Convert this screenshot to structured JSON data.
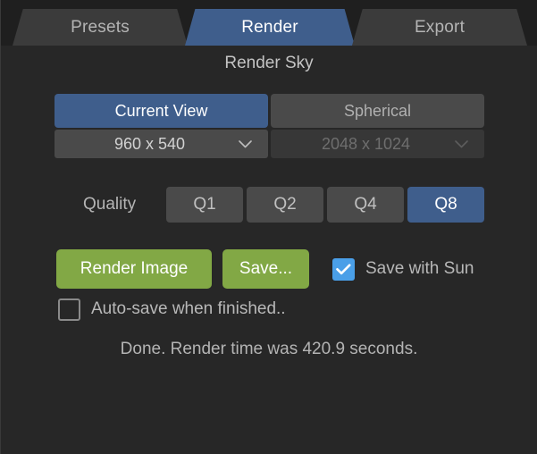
{
  "window": {
    "background": "#272727",
    "accent_blue": "#3f5e8c",
    "accent_green": "#82a845",
    "checkbox_blue": "#4a9fe8"
  },
  "tabs": [
    {
      "label": "Presets",
      "active": false
    },
    {
      "label": "Render",
      "active": true
    },
    {
      "label": "Export",
      "active": false
    }
  ],
  "panel": {
    "title": "Render Sky",
    "view_modes": [
      {
        "label": "Current View",
        "selected": true
      },
      {
        "label": "Spherical",
        "selected": false
      }
    ],
    "resolutions": [
      {
        "value": "960 x 540",
        "disabled": false,
        "icon": "chevron-down-icon"
      },
      {
        "value": "2048 x 1024",
        "disabled": true,
        "icon": "chevron-down-icon"
      }
    ],
    "quality": {
      "label": "Quality",
      "options": [
        {
          "label": "Q1",
          "selected": false
        },
        {
          "label": "Q2",
          "selected": false
        },
        {
          "label": "Q4",
          "selected": false
        },
        {
          "label": "Q8",
          "selected": true
        }
      ]
    },
    "actions": {
      "render_label": "Render Image",
      "save_label": "Save..."
    },
    "save_with_sun": {
      "label": "Save with Sun",
      "checked": true,
      "icon": "check-icon"
    },
    "auto_save": {
      "label": "Auto-save when finished..",
      "checked": false
    },
    "status": "Done. Render time was 420.9 seconds."
  }
}
